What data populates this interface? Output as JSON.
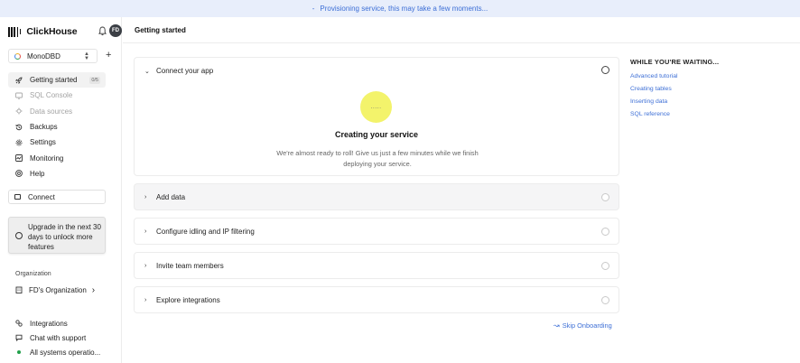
{
  "banner": {
    "dash": "-",
    "text": "Provisioning service, this may take a few moments..."
  },
  "sidebar": {
    "brand": "ClickHouse",
    "avatar_initials": "FD",
    "service_name": "MonoDBD",
    "nav": [
      {
        "label": "Getting started",
        "icon": "rocket-icon",
        "badge": "0/5",
        "state": "active"
      },
      {
        "label": "SQL Console",
        "icon": "terminal-icon",
        "state": "disabled"
      },
      {
        "label": "Data sources",
        "icon": "data-sources-icon",
        "state": "disabled"
      },
      {
        "label": "Backups",
        "icon": "backups-icon",
        "state": "normal"
      },
      {
        "label": "Settings",
        "icon": "gear-icon",
        "state": "normal"
      },
      {
        "label": "Monitoring",
        "icon": "monitoring-icon",
        "state": "normal"
      },
      {
        "label": "Help",
        "icon": "help-icon",
        "state": "normal"
      }
    ],
    "connect_label": "Connect",
    "upgrade_text": "Upgrade in the next 30 days to unlock more features",
    "org_label": "Organization",
    "org_name": "FD's Organization",
    "bottom": [
      {
        "label": "Integrations",
        "icon": "integrations-icon"
      },
      {
        "label": "Chat with support",
        "icon": "chat-icon"
      },
      {
        "label": "All systems operatio...",
        "icon": "status-dot-icon"
      }
    ]
  },
  "main": {
    "page_title": "Getting started",
    "connect_card": {
      "title": "Connect your app",
      "loader_text": ".....",
      "creating_title": "Creating your service",
      "creating_sub": "We're almost ready to roll! Give us just a few minutes while we finish deploying your service."
    },
    "steps": [
      {
        "title": "Add data"
      },
      {
        "title": "Configure idling and IP filtering"
      },
      {
        "title": "Invite team members"
      },
      {
        "title": "Explore integrations"
      }
    ],
    "skip_label": "Skip Onboarding"
  },
  "waiting": {
    "title": "WHILE YOU'RE WAITING...",
    "links": [
      "Advanced tutorial",
      "Creating tables",
      "Inserting data",
      "SQL reference"
    ]
  },
  "colors": {
    "accent": "#3d6fd6",
    "banner_bg": "#e8eefb",
    "loader": "#f3f36b",
    "status_ok": "#22a04b"
  }
}
